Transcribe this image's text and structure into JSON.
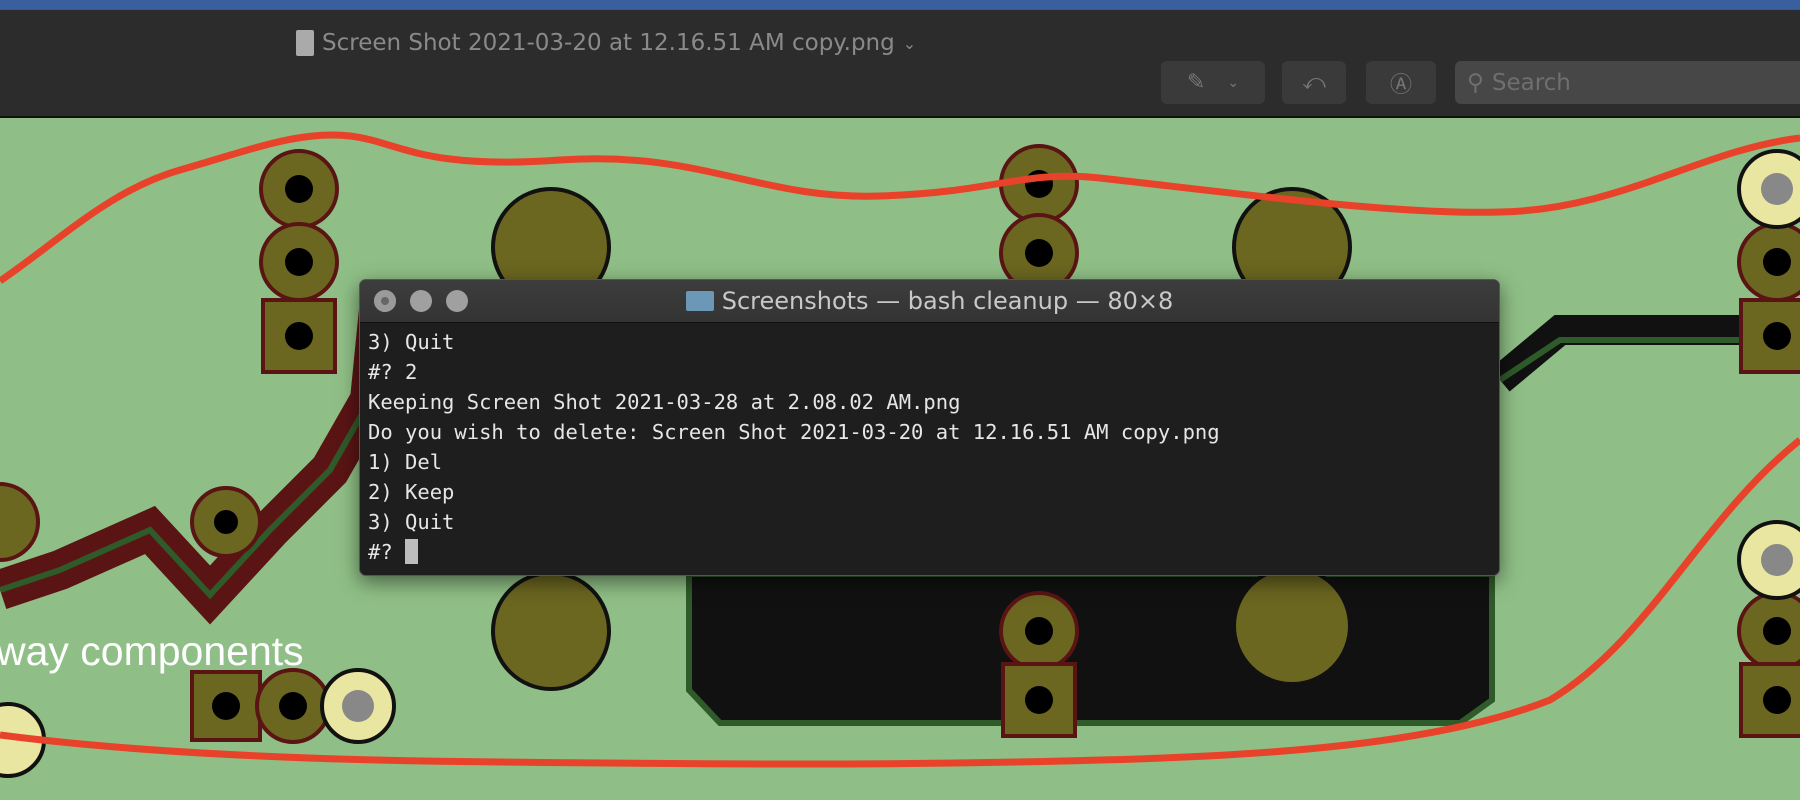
{
  "window": {
    "title": "Screen Shot 2021-03-20 at 12.16.51 AM copy.png"
  },
  "toolbar": {
    "markup_icon": "pen-markup-icon",
    "rotate_icon": "rotate-left-icon",
    "annotate_icon": "pen-circle-icon",
    "search_placeholder": "Search"
  },
  "background": {
    "label": "way components"
  },
  "terminal": {
    "title": "Screenshots — bash cleanup — 80×8",
    "lines": [
      "3) Quit",
      "#? 2",
      "Keeping Screen Shot 2021-03-28 at 2.08.02 AM.png",
      "Do you wish to delete: Screen Shot 2021-03-20 at 12.16.51 AM copy.png",
      "1) Del",
      "2) Keep",
      "3) Quit"
    ],
    "prompt": "#? "
  },
  "colors": {
    "pcb": "#8fbf86",
    "trace": "#e8432a",
    "pad": "#6b6620"
  }
}
